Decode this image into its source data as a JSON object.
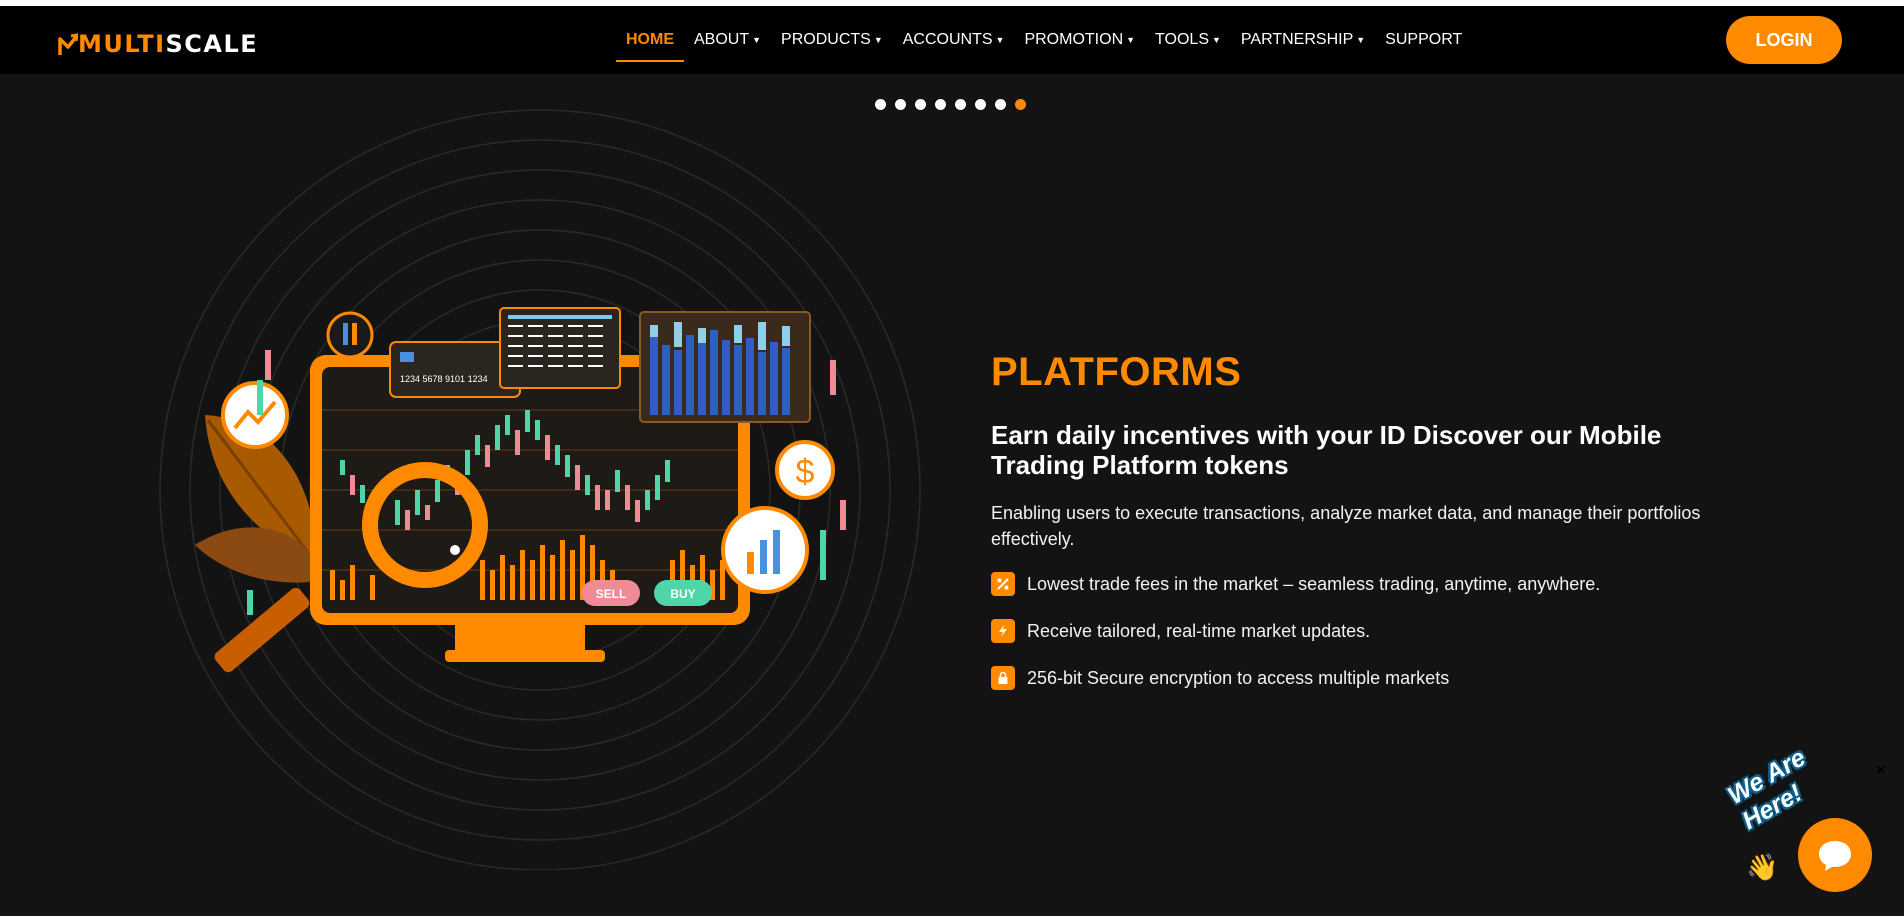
{
  "brand": {
    "logo_part1": "MULTI",
    "logo_part2": "SCALE"
  },
  "nav": {
    "items": [
      {
        "label": "HOME",
        "has_dropdown": false,
        "active": true
      },
      {
        "label": "ABOUT",
        "has_dropdown": true
      },
      {
        "label": "PRODUCTS",
        "has_dropdown": true
      },
      {
        "label": "ACCOUNTS",
        "has_dropdown": true
      },
      {
        "label": "PROMOTION",
        "has_dropdown": true
      },
      {
        "label": "TOOLS",
        "has_dropdown": true
      },
      {
        "label": "PARTNERSHIP",
        "has_dropdown": true
      },
      {
        "label": "SUPPORT",
        "has_dropdown": false
      }
    ],
    "login_label": "LOGIN"
  },
  "carousel": {
    "total_slides": 8,
    "active_index": 7
  },
  "hero": {
    "title": "PLATFORMS",
    "subtitle": "Earn daily incentives with your ID Discover our Mobile Trading Platform tokens",
    "description": "Enabling users to execute transactions, analyze market data, and manage their portfolios effectively.",
    "features": [
      {
        "icon": "percent-tag-icon",
        "text": "Lowest trade fees in the market – seamless trading, anytime, anywhere."
      },
      {
        "icon": "lightning-icon",
        "text": "Receive tailored, real-time market updates."
      },
      {
        "icon": "lock-icon",
        "text": "256-bit Secure encryption to access multiple markets"
      }
    ],
    "illustration": {
      "card_number": "1234 5678 9101 1234",
      "sell_label": "SELL",
      "buy_label": "BUY",
      "dollar_symbol": "$"
    }
  },
  "chat": {
    "label": "We Are Here!",
    "close_symbol": "×"
  },
  "colors": {
    "accent": "#ff8a00",
    "background": "#131313",
    "navbar": "#000000",
    "buy": "#4fd6a8",
    "sell": "#f08a95"
  }
}
